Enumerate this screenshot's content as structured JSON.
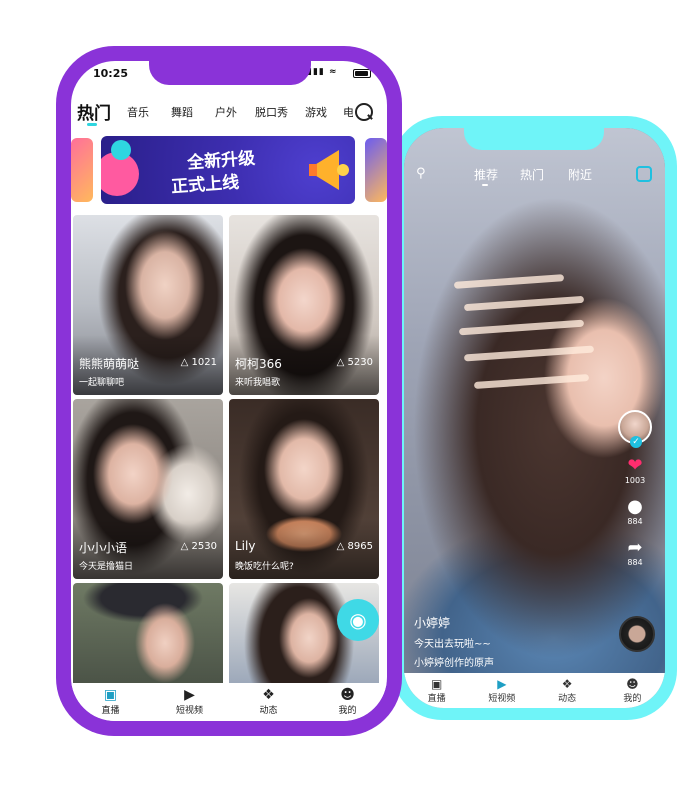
{
  "live_phone": {
    "status_bar": {
      "time": "10:25"
    },
    "categories": [
      "热门",
      "音乐",
      "舞蹈",
      "户外",
      "脱口秀",
      "游戏",
      "电"
    ],
    "active_category": "热门",
    "banner": {
      "line1": "全新升级",
      "line2": "正式上线"
    },
    "cards": [
      {
        "name": "熊熊萌萌哒",
        "viewers": "1021",
        "subtitle": "一起聊聊吧"
      },
      {
        "name": "柯柯366",
        "viewers": "5230",
        "subtitle": "来听我唱歌"
      },
      {
        "name": "小小小语",
        "viewers": "2530",
        "subtitle": "今天是撸猫日"
      },
      {
        "name": "Lily",
        "viewers": "8965",
        "subtitle": "晚饭吃什么呢?"
      }
    ],
    "tabs": [
      {
        "label": "直播",
        "icon": "tv-icon",
        "active": true
      },
      {
        "label": "短视频",
        "icon": "play-circle-icon",
        "active": false
      },
      {
        "label": "动态",
        "icon": "compass-icon",
        "active": false
      },
      {
        "label": "我的",
        "icon": "face-icon",
        "active": false
      }
    ]
  },
  "video_phone": {
    "top_tabs": [
      "推荐",
      "热门",
      "附近"
    ],
    "active_top_tab": "推荐",
    "likes": "1003",
    "comments": "884",
    "shares": "884",
    "author": "小婷婷",
    "caption": "今天出去玩啦~~",
    "music": "小婷婷创作的原声",
    "tabs": [
      {
        "label": "直播",
        "icon": "tv-icon"
      },
      {
        "label": "短视频",
        "icon": "play-circle-icon",
        "active": true
      },
      {
        "label": "动态",
        "icon": "compass-icon"
      },
      {
        "label": "我的",
        "icon": "face-icon"
      }
    ]
  },
  "colors": {
    "purple_frame": "#8a33d8",
    "cyan_frame": "#6ff4f8",
    "accent": "#2fd6e0",
    "like": "#ff2d6f"
  }
}
